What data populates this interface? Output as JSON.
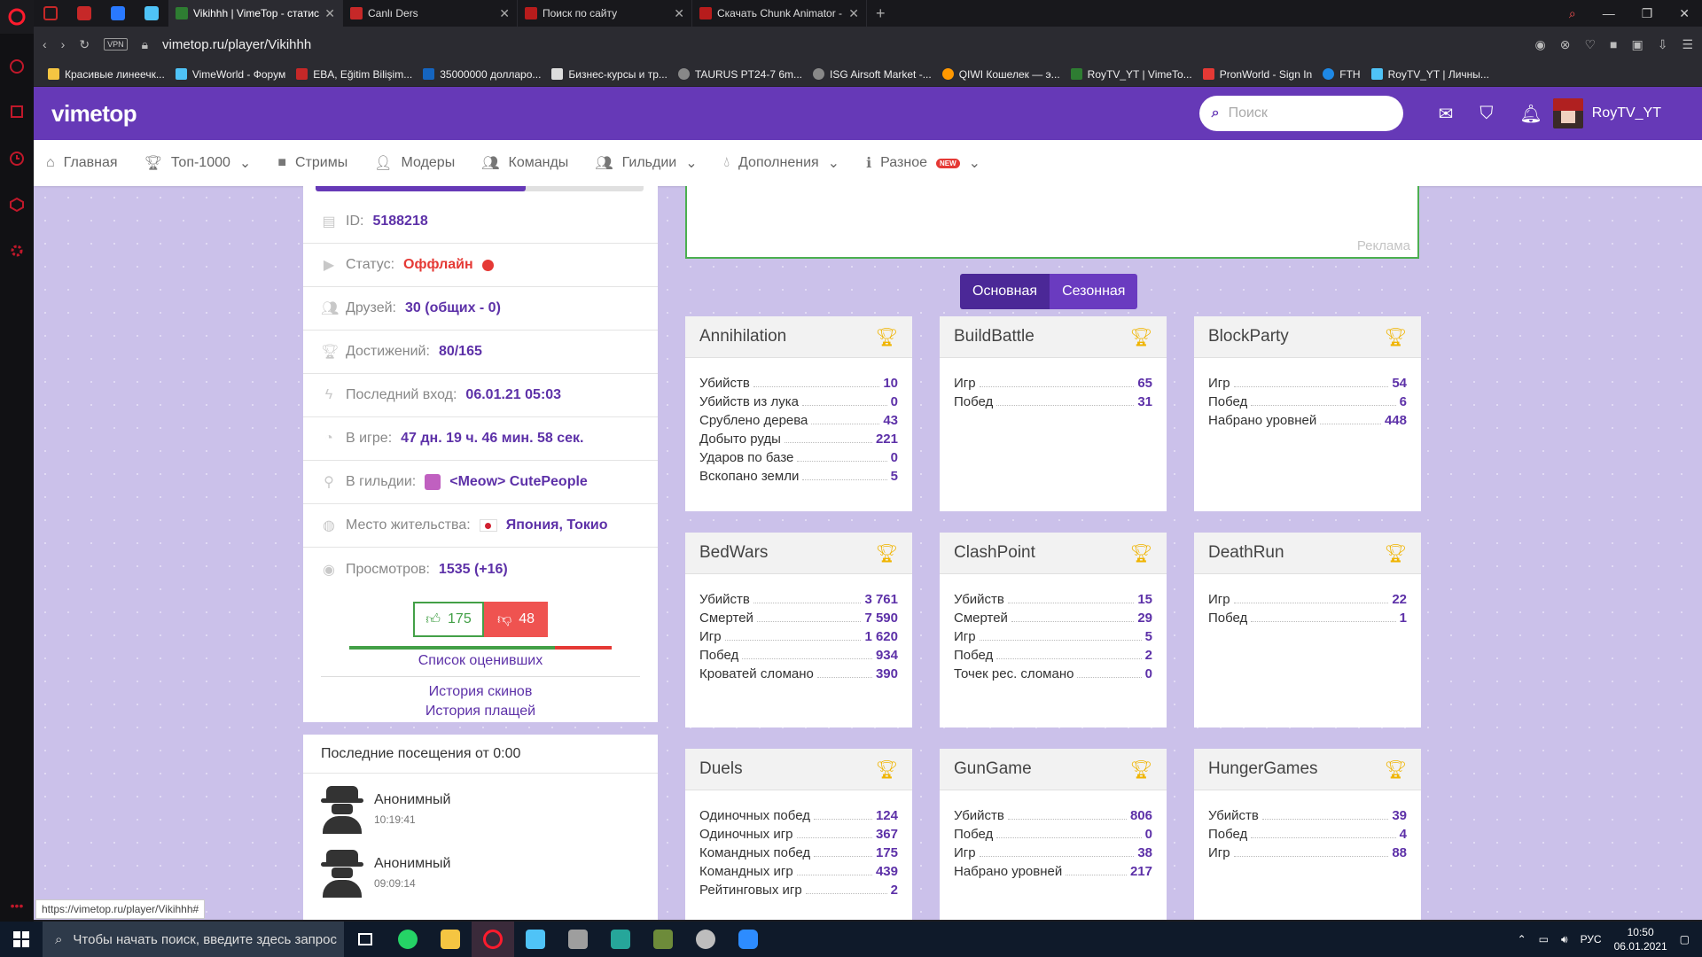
{
  "browser": {
    "tabs": [
      {
        "title": "Vikihhh | VimeTop - статис",
        "active": true,
        "color": "#2e7d32"
      },
      {
        "title": "Canlı Ders",
        "active": false,
        "color": "#c62828"
      },
      {
        "title": "Поиск по сайту",
        "active": false,
        "color": "#b71c1c"
      },
      {
        "title": "Скачать Chunk Animator -",
        "active": false,
        "color": "#b71c1c"
      }
    ],
    "url": "vimetop.ru/player/Vikihhh",
    "vpn_label": "VPN",
    "bookmarks": [
      "Красивые линеечк...",
      "VimeWorld - Форум",
      "EBA, Eğitim Bilişim...",
      "35000000 долларо...",
      "Бизнес-курсы и тр...",
      "TAURUS PT24-7 6m...",
      "ISG Airsoft Market -...",
      "QIWI Кошелек — э...",
      "RoyTV_YT | VimeTo...",
      "PronWorld - Sign In",
      "FTH",
      "RoyTV_YT | Личны..."
    ],
    "status_url": "https://vimetop.ru/player/Vikihhh#"
  },
  "site": {
    "brand": "vimetop",
    "search_placeholder": "Поиск",
    "username": "RoyTV_YT",
    "nav": [
      {
        "label": "Главная",
        "icon": "home-icon",
        "dropdown": false
      },
      {
        "label": "Топ-1000",
        "icon": "trophy-icon",
        "dropdown": true
      },
      {
        "label": "Стримы",
        "icon": "video-icon",
        "dropdown": false
      },
      {
        "label": "Модеры",
        "icon": "moderator-icon",
        "dropdown": false
      },
      {
        "label": "Команды",
        "icon": "team-icon",
        "dropdown": false
      },
      {
        "label": "Гильдии",
        "icon": "guild-icon",
        "dropdown": true
      },
      {
        "label": "Дополнения",
        "icon": "drop-icon",
        "dropdown": true
      },
      {
        "label": "Разное",
        "icon": "info-icon",
        "dropdown": true,
        "badge": "NEW"
      }
    ]
  },
  "profile": {
    "level_progress": 0.64,
    "id_label": "ID:",
    "id_value": "5188218",
    "status_label": "Статус:",
    "status_value": "Оффлайн",
    "friends_label": "Друзей:",
    "friends_value": "30 (общих - 0)",
    "achievements_label": "Достижений:",
    "achievements_value": "80/165",
    "last_login_label": "Последний вход:",
    "last_login_value": "06.01.21 05:03",
    "ingame_label": "В игре:",
    "ingame_value": "47 дн. 19 ч. 46 мин. 58 сек.",
    "guild_label": "В гильдии:",
    "guild_value": "<Meow> CutePeople",
    "residence_label": "Место жительства:",
    "residence_value": "Япония, Токио",
    "views_label": "Просмотров:",
    "views_value": "1535 (+16)",
    "likes": "175",
    "dislikes": "48",
    "like_ratio": 0.785,
    "raters_link": "Список оценивших",
    "skins_link": "История скинов",
    "capes_link": "История плащей"
  },
  "visits": {
    "title": "Последние посещения от 0:00",
    "items": [
      {
        "name": "Анонимный",
        "time": "10:19:41"
      },
      {
        "name": "Анонимный",
        "time": "09:09:14"
      }
    ]
  },
  "ad_label": "Реклама",
  "stats_toggle": {
    "main": "Основная",
    "season": "Сезонная"
  },
  "games": [
    {
      "title": "Annihilation",
      "stats": [
        [
          "Убийств",
          "10"
        ],
        [
          "Убийств из лука",
          "0"
        ],
        [
          "Срублено дерева",
          "43"
        ],
        [
          "Добыто руды",
          "221"
        ],
        [
          "Ударов по базе",
          "0"
        ],
        [
          "Вскопано земли",
          "5"
        ]
      ]
    },
    {
      "title": "BuildBattle",
      "stats": [
        [
          "Игр",
          "65"
        ],
        [
          "Побед",
          "31"
        ]
      ]
    },
    {
      "title": "BlockParty",
      "stats": [
        [
          "Игр",
          "54"
        ],
        [
          "Побед",
          "6"
        ],
        [
          "Набрано уровней",
          "448"
        ]
      ]
    },
    {
      "title": "BedWars",
      "stats": [
        [
          "Убийств",
          "3 761"
        ],
        [
          "Смертей",
          "7 590"
        ],
        [
          "Игр",
          "1 620"
        ],
        [
          "Побед",
          "934"
        ],
        [
          "Кроватей сломано",
          "390"
        ]
      ]
    },
    {
      "title": "ClashPoint",
      "stats": [
        [
          "Убийств",
          "15"
        ],
        [
          "Смертей",
          "29"
        ],
        [
          "Игр",
          "5"
        ],
        [
          "Побед",
          "2"
        ],
        [
          "Точек рес. сломано",
          "0"
        ]
      ]
    },
    {
      "title": "DeathRun",
      "stats": [
        [
          "Игр",
          "22"
        ],
        [
          "Побед",
          "1"
        ]
      ]
    },
    {
      "title": "Duels",
      "stats": [
        [
          "Одиночных побед",
          "124"
        ],
        [
          "Одиночных игр",
          "367"
        ],
        [
          "Командных побед",
          "175"
        ],
        [
          "Командных игр",
          "439"
        ],
        [
          "Рейтинговых игр",
          "2"
        ]
      ]
    },
    {
      "title": "GunGame",
      "stats": [
        [
          "Убийств",
          "806"
        ],
        [
          "Побед",
          "0"
        ],
        [
          "Игр",
          "38"
        ],
        [
          "Набрано уровней",
          "217"
        ]
      ]
    },
    {
      "title": "HungerGames",
      "stats": [
        [
          "Убийств",
          "39"
        ],
        [
          "Побед",
          "4"
        ],
        [
          "Игр",
          "88"
        ]
      ]
    }
  ],
  "taskbar": {
    "search_placeholder": "Чтобы начать поиск, введите здесь запрос",
    "lang": "РУС",
    "time": "10:50",
    "date": "06.01.2021"
  }
}
